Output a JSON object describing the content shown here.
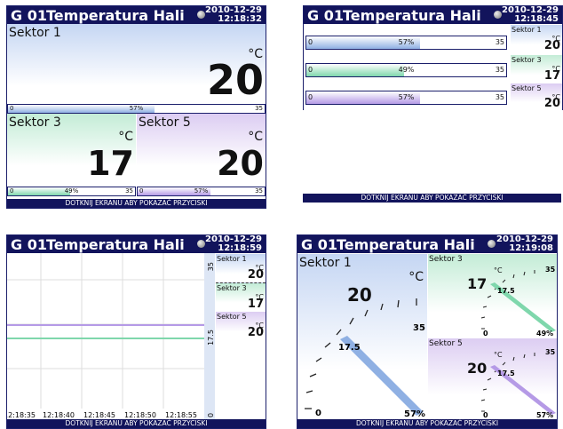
{
  "header": {
    "id": "G 01",
    "title": "Temperatura Hali"
  },
  "footer": "DOTKNIJ EKRANU ABY POKAZAĆ PRZYCISKI",
  "unit": "°C",
  "sectors": [
    {
      "name": "Sektor 1",
      "value": "20",
      "min": "0",
      "max": "35",
      "percent": "57%",
      "fill": 0.57
    },
    {
      "name": "Sektor 3",
      "value": "17",
      "min": "0",
      "max": "35",
      "percent": "49%",
      "fill": 0.49
    },
    {
      "name": "Sektor 5",
      "value": "20",
      "min": "0",
      "max": "35",
      "percent": "57%",
      "fill": 0.57
    }
  ],
  "screens": {
    "tiles": {
      "date": "2010-12-29",
      "time": "12:18:32"
    },
    "bars": {
      "date": "2010-12-29",
      "time": "12:18:45"
    },
    "trend": {
      "date": "2010-12-29",
      "time": "12:18:59",
      "x_labels": [
        "12:18:35",
        "12:18:40",
        "12:18:45",
        "12:18:50",
        "12:18:55"
      ],
      "y_labels": [
        "35",
        "17.5",
        "0"
      ]
    },
    "gauges": {
      "date": "2010-12-29",
      "time": "12:19:08",
      "mid": "17.5"
    }
  },
  "colors": {
    "header": "#12145c",
    "blue": "#8fb0e3",
    "green": "#7fd7ac",
    "purple": "#b59ae6"
  }
}
